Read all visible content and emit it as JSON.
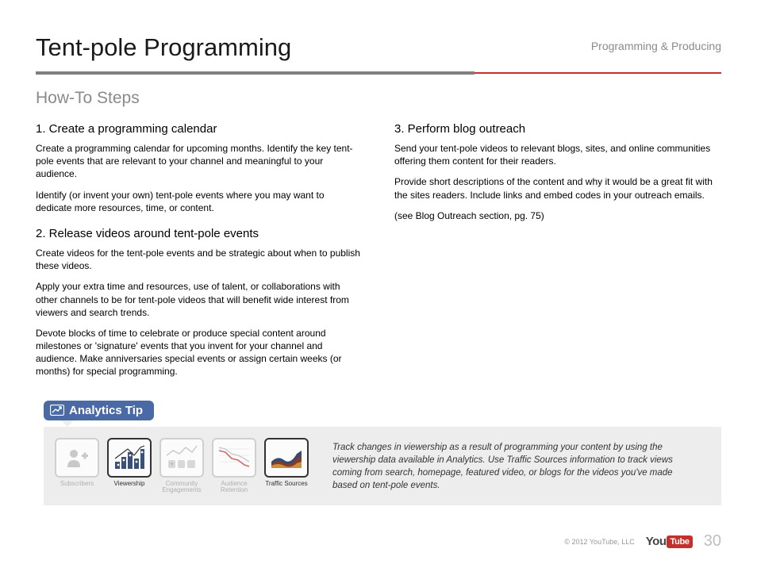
{
  "header": {
    "title": "Tent-pole Programming",
    "category": "Programming & Producing"
  },
  "subhead": "How-To Steps",
  "left": {
    "step1_head": "1. Create a programming calendar",
    "step1_p1": "Create a programming calendar for upcoming months. Identify the key tent-pole events that are relevant to your channel and meaningful to your audience.",
    "step1_p2": "Identify (or invent your own) tent-pole events where you may want to dedicate more resources, time, or content.",
    "step2_head": "2. Release videos around tent-pole events",
    "step2_p1": "Create videos for the tent-pole events and be strategic about when to publish these videos.",
    "step2_p2": "Apply your extra time and resources, use of talent, or collaborations with other channels to be for tent-pole videos that will benefit wide interest from viewers and search trends.",
    "step2_p3": "Devote blocks of time to celebrate or produce special content around milestones or 'signature' events that you invent for your channel and audience. Make anniversaries special events or assign certain weeks (or months) for special programming."
  },
  "right": {
    "step3_head": "3. Perform blog outreach",
    "step3_p1": "Send your tent-pole videos to relevant blogs, sites, and online communities offering them content for their readers.",
    "step3_p2": "Provide short descriptions of the content and why it would be a great fit with the sites readers. Include links and embed codes in your outreach emails.",
    "step3_p3": "(see Blog Outreach section, pg. 75)"
  },
  "tip": {
    "badge": "Analytics Tip",
    "tiles": {
      "subscribers": "Subscribers",
      "viewership": "Viewership",
      "community": "Community Engagements",
      "retention": "Audience Retention",
      "traffic": "Traffic Sources"
    },
    "text": "Track changes in viewership as a result of programming your content by using the viewership data available in Analytics. Use Traffic Sources information to track views coming from search, homepage, featured video, or blogs for the videos you've made based on tent-pole events."
  },
  "footer": {
    "copyright": "© 2012 YouTube, LLC",
    "logo_you": "You",
    "logo_tube": "Tube",
    "page": "30"
  }
}
